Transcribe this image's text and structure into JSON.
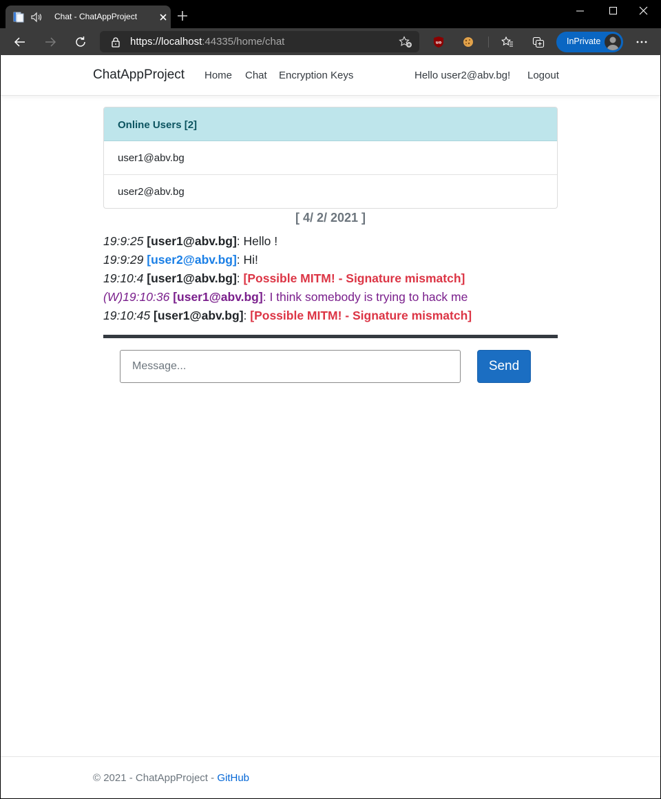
{
  "browser": {
    "tab_title": "Chat - ChatAppProject",
    "url": {
      "scheme": "https://",
      "host": "localhost",
      "rest": ":44335/home/chat"
    },
    "inprivate_label": "InPrivate",
    "icons": {
      "page": "page-icon",
      "audio": "speaker-icon",
      "close_tab": "close-icon",
      "new_tab": "plus-icon",
      "back": "arrow-left-icon",
      "forward": "arrow-right-icon",
      "reload": "reload-icon",
      "lock": "lock-icon",
      "add_favorite": "star-plus-icon",
      "ublock": "ublock-shield-icon",
      "cookie": "cookie-icon",
      "favorites": "star-list-icon",
      "collections": "collections-icon",
      "more": "ellipsis-icon"
    }
  },
  "navbar": {
    "brand": "ChatAppProject",
    "links": [
      "Home",
      "Chat",
      "Encryption Keys"
    ],
    "greeting": "Hello user2@abv.bg!",
    "logout": "Logout"
  },
  "online_users": {
    "header": "Online Users [2]",
    "users": [
      "user1@abv.bg",
      "user2@abv.bg"
    ]
  },
  "chat": {
    "date": "[ 4/ 2/ 2021 ]",
    "messages": [
      {
        "prefix": "",
        "time": "19:9:25",
        "user": "[user1@abv.bg]",
        "sep": ": ",
        "text": "Hello !",
        "type": "normal"
      },
      {
        "prefix": "",
        "time": "19:9:29",
        "user": "[user2@abv.bg]",
        "sep": ": ",
        "text": "Hi!",
        "type": "self"
      },
      {
        "prefix": "",
        "time": "19:10:4",
        "user": "[user1@abv.bg]",
        "sep": ": ",
        "text": "[Possible MITM! - Signature mismatch]",
        "type": "alert"
      },
      {
        "prefix": "(W)",
        "time": "19:10:36",
        "user": "[user1@abv.bg]",
        "sep": ": ",
        "text": "I think somebody is trying to hack me",
        "type": "whisper"
      },
      {
        "prefix": "",
        "time": "19:10:45",
        "user": "[user1@abv.bg]",
        "sep": ": ",
        "text": "[Possible MITM! - Signature mismatch]",
        "type": "alert"
      }
    ],
    "input_placeholder": "Message...",
    "input_value": "",
    "send_label": "Send"
  },
  "footer": {
    "text": "© 2021 - ChatAppProject - ",
    "link": "GitHub"
  },
  "colors": {
    "alert": "#dc3545",
    "self_user": "#1a7fe6",
    "whisper": "#7a1f8c",
    "card_header_bg": "#bee5eb",
    "primary_button": "#1b6ec2"
  }
}
